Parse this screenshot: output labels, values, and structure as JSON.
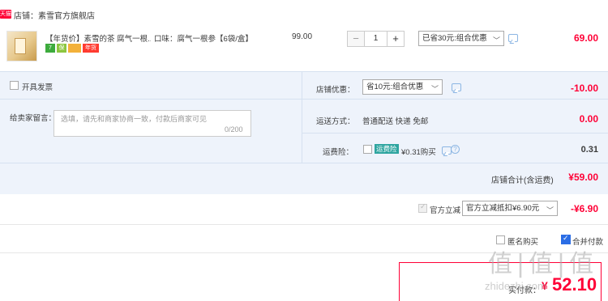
{
  "shop": {
    "badge": "天猫",
    "name": "店铺：素雪官方旗舰店"
  },
  "item": {
    "title": "【年货价】素雪的茶 腐气一根...",
    "tags": [
      "7",
      "保",
      "",
      "年货"
    ],
    "sku": "口味：腐气一根参【6袋/盒】",
    "unit_price": "99.00",
    "quantity": "1",
    "qty_minus": "−",
    "qty_plus": "+",
    "discount_select": "已省30元:组合优惠",
    "total": "69.00"
  },
  "options": {
    "anonymous_label": "开具发票",
    "message_label": "给卖家留言：",
    "message_placeholder": "选填，请先和商家协商一致，付款后商家可见",
    "message_count": "0/200",
    "coupon_label": "店铺优惠：",
    "coupon_select": "省10元:组合优惠",
    "coupon_value": "-10.00",
    "shipping_label": "运送方式：",
    "shipping_method": "普通配送 快递 免邮",
    "shipping_value": "0.00",
    "insurance_label": "运费险：",
    "insurance_badge": "运费险",
    "insurance_price": "¥0.31购买",
    "insurance_value": "0.31",
    "shop_total_label": "店铺合计(含运费)",
    "shop_total_value": "¥59.00"
  },
  "official": {
    "label": "官方立减",
    "select": "官方立减抵扣¥6.90元",
    "value": "-¥6.90"
  },
  "submit_options": {
    "option1": "匿名购买",
    "option2": "合并付款"
  },
  "pay": {
    "label": "实付款：",
    "currency": "¥",
    "amount": "52.10"
  },
  "watermark": {
    "glyphs": "值|值|值",
    "text": "zhidezhi.com"
  },
  "colors": {
    "accent_red": "#ff0036",
    "panel_blue": "#eef3fb",
    "insurance_green": "#2ea5a0"
  },
  "icons": {
    "dropdown": "chevron-down-icon",
    "chat": "chat-bubble-icon",
    "help": "question-circle-icon"
  }
}
